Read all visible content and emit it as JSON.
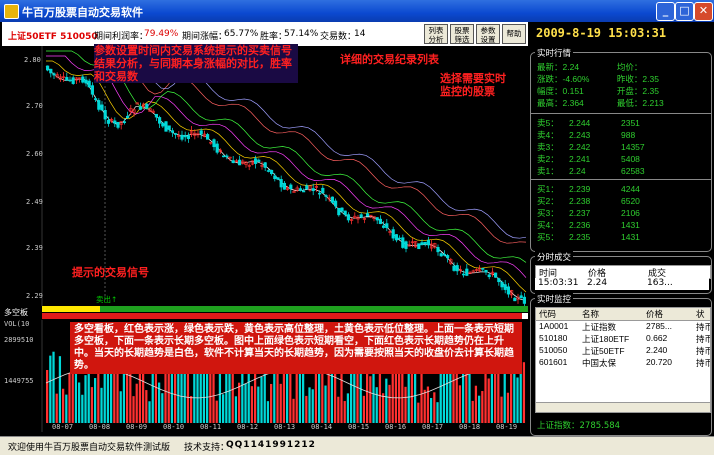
{
  "window": {
    "title": "牛百万股票自动交易软件",
    "buttons": [
      "_",
      "□",
      "✕"
    ]
  },
  "infobar": {
    "symbol": "上证50ETF  510050",
    "period_return_label": "期间利润率：",
    "period_return": "79.49%",
    "period_rise_label": "期间涨幅：",
    "period_rise": "65.77%",
    "win_rate_label": "胜率：",
    "win_rate": "57.14%",
    "trades_label": "交易数：",
    "trades": "14"
  },
  "toolbar": {
    "buttons": [
      {
        "line1": "列表",
        "line2": "分析"
      },
      {
        "line1": "股票",
        "line2": "筛选"
      },
      {
        "line1": "参数",
        "line2": "设置"
      },
      {
        "line1": "帮助",
        "line2": ""
      }
    ]
  },
  "chart": {
    "y_ticks": [
      "2.80",
      "2.70",
      "2.60",
      "2.49",
      "2.39",
      "2.29"
    ],
    "annotations": {
      "params": "参数设置时间内交易系统提示的买卖信号结果分析，与同期本身涨幅的对比，胜率和交易数",
      "detail": "详细的交易纪录列表",
      "select": "选择需要实时监控的股票",
      "signal": "提示的交易信号"
    },
    "sell_label": "卖出↑",
    "colors": {
      "up": "#ff3030",
      "down": "#00d8d8",
      "bg": "#000000"
    }
  },
  "signalbar": {
    "label": "多空板"
  },
  "volume": {
    "label": "VOL(10",
    "y_ticks": [
      "2899510",
      "1449755"
    ],
    "dates": [
      "08-07",
      "08-08",
      "08-09",
      "08-10",
      "08-11",
      "08-12",
      "08-13",
      "08-14",
      "08-15",
      "08-16",
      "08-17",
      "08-18",
      "08-19"
    ],
    "note": "多空看板，红色表示涨，绿色表示跌，黄色表示高位整理，土黄色表示低位整理。上面一条表示短期多空板，下面一条表示长期多空板。图中上面绿色表示短期看空，下面红色表示长期趋势仍在上升中。当天的长期趋势是白色，软件不计算当天的长期趋势，因为需要按照当天的收盘价去计算长期趋势。"
  },
  "statusbar": {
    "welcome": "欢迎使用牛百万股票自动交易软件测试版",
    "support_label": "技术支持：",
    "support_qq": "QQ1141991212"
  },
  "right": {
    "clock": "2009-8-19  15:03:31",
    "realtime_title": "实时行情",
    "quote": [
      {
        "l": "最新：",
        "v": "2.24",
        "l2": "均价：",
        "v2": ""
      },
      {
        "l": "涨跌：",
        "v": "-4.60%",
        "l2": "昨收：",
        "v2": "2.35"
      },
      {
        "l": "幅度：",
        "v": "0.151",
        "l2": "开盘：",
        "v2": "2.35"
      },
      {
        "l": "最高：",
        "v": "2.364",
        "l2": "最低：",
        "v2": "2.213"
      }
    ],
    "sells": [
      {
        "l": "卖5：",
        "p": "2.244",
        "q": "2351"
      },
      {
        "l": "卖4：",
        "p": "2.243",
        "q": "988"
      },
      {
        "l": "卖3：",
        "p": "2.242",
        "q": "14357"
      },
      {
        "l": "卖2：",
        "p": "2.241",
        "q": "5408"
      },
      {
        "l": "卖1：",
        "p": "2.24",
        "q": "62583"
      }
    ],
    "buys": [
      {
        "l": "买1：",
        "p": "2.239",
        "q": "4244"
      },
      {
        "l": "买2：",
        "p": "2.238",
        "q": "6520"
      },
      {
        "l": "买3：",
        "p": "2.237",
        "q": "2106"
      },
      {
        "l": "买4：",
        "p": "2.236",
        "q": "1431"
      },
      {
        "l": "买5：",
        "p": "2.235",
        "q": "1431"
      }
    ],
    "ticks_title": "分时成交",
    "ticks_headers": [
      "时间",
      "价格",
      "成交"
    ],
    "ticks_row": [
      "15:03:31",
      "2.24",
      "163..."
    ],
    "watch_title": "实时监控",
    "watch_headers": [
      "代码",
      "名称",
      "价格",
      "状"
    ],
    "watch_rows": [
      {
        "code": "1A0001",
        "name": "上证指数",
        "price": "2785...",
        "status": "持币"
      },
      {
        "code": "510180",
        "name": "上证180ETF",
        "price": "0.662",
        "status": "持币"
      },
      {
        "code": "510050",
        "name": "上证50ETF",
        "price": "2.240",
        "status": "持币"
      },
      {
        "code": "601601",
        "name": "中国太保",
        "price": "20.720",
        "status": "持币"
      }
    ],
    "index_footer": "上证指数：2785.584"
  }
}
